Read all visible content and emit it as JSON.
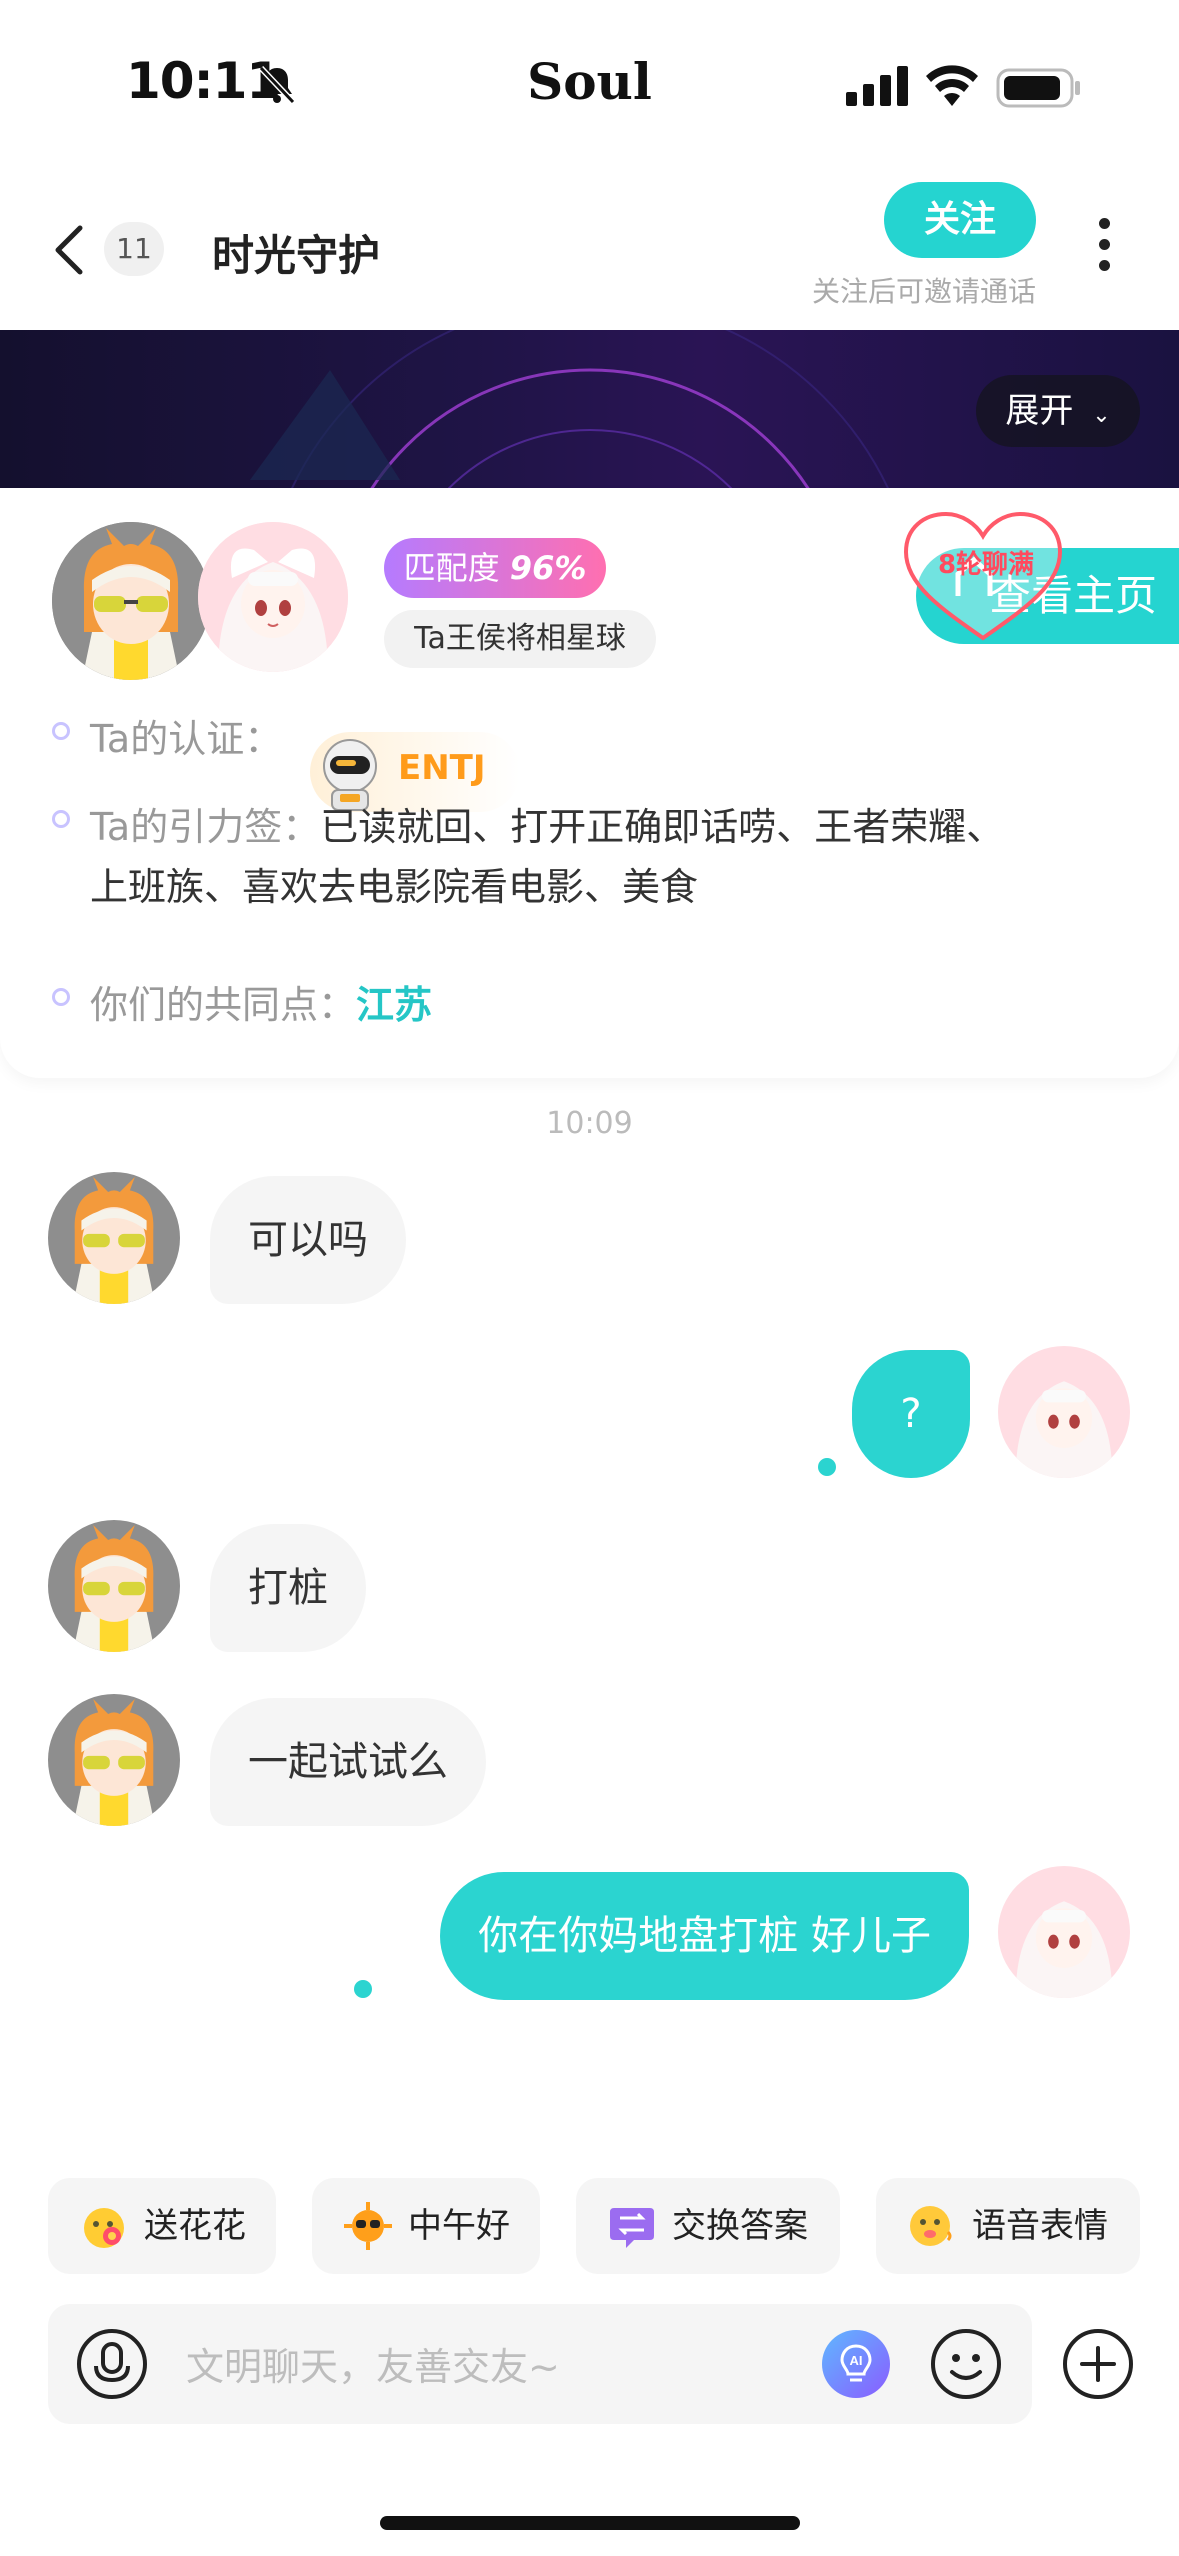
{
  "status_bar": {
    "time": "10:11",
    "center_label": "Soul"
  },
  "header": {
    "back_icon": "chevron-left-icon",
    "unread_count": "11",
    "title": "时光守护",
    "follow_label": "关注",
    "follow_hint": "关注后可邀请通话",
    "more_icon": "more-vertical-icon"
  },
  "banner": {
    "expand_label": "展开"
  },
  "profile": {
    "match_prefix": "匹配度",
    "match_value": "96%",
    "tag": "Ta王侯将相星球",
    "rounds_badge": "8轮聊满",
    "visit_label": "查看主页",
    "certification_label": "Ta的认证：",
    "mbti": "ENTJ",
    "gravity_label": "Ta的引力签：",
    "gravity_line1": "已读就回、打开正确即话唠、王者荣耀、",
    "gravity_line2": "上班族、喜欢去电影院看电影、美食",
    "common_label": "你们的共同点：",
    "common_value": "江苏"
  },
  "chat": {
    "timestamp": "10:09",
    "messages": [
      {
        "side": "in",
        "text": "可以吗"
      },
      {
        "side": "out",
        "text": "?"
      },
      {
        "side": "in",
        "text": "打桩"
      },
      {
        "side": "in",
        "text": "一起试试么"
      },
      {
        "side": "out",
        "text": "你在你妈地盘打桩 好儿子"
      }
    ]
  },
  "quick_replies": [
    {
      "label": "送花花",
      "icon": "flower-emoji-icon"
    },
    {
      "label": "中午好",
      "icon": "sun-sunglasses-icon"
    },
    {
      "label": "交换答案",
      "icon": "exchange-icon"
    },
    {
      "label": "语音表情",
      "icon": "voice-emoji-icon"
    }
  ],
  "input": {
    "placeholder": "文明聊天，友善交友~",
    "voice_icon": "microphone-icon",
    "ai_icon": "ai-bulb-icon",
    "emoji_icon": "smiley-icon",
    "add_icon": "plus-circle-icon"
  },
  "colors": {
    "accent": "#25d4d0",
    "match_gradient_start": "#b57bff",
    "match_gradient_end": "#ff6fb0",
    "mbti_orange": "#ff9b1a",
    "banner_dark": "#1f1446"
  }
}
